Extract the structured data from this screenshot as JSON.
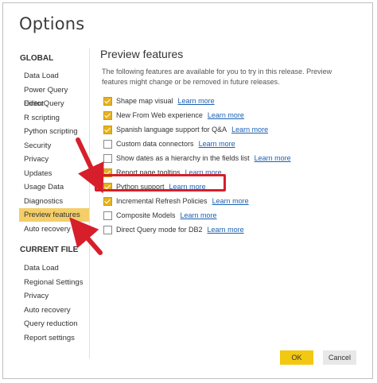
{
  "window": {
    "title": "Options"
  },
  "sidebar": {
    "global_header": "GLOBAL",
    "global_items": [
      "Data Load",
      "Power Query Editor",
      "DirectQuery",
      "R scripting",
      "Python scripting",
      "Security",
      "Privacy",
      "Updates",
      "Usage Data",
      "Diagnostics",
      "Preview features",
      "Auto recovery"
    ],
    "selected_index": 10,
    "current_header": "CURRENT FILE",
    "current_items": [
      "Data Load",
      "Regional Settings",
      "Privacy",
      "Auto recovery",
      "Query reduction",
      "Report settings"
    ]
  },
  "main": {
    "title": "Preview features",
    "description": "The following features are available for you to try in this release. Preview features might change or be removed in future releases.",
    "link_label": "Learn more",
    "features": [
      {
        "label": "Shape map visual",
        "checked": true
      },
      {
        "label": "New From Web experience",
        "checked": true
      },
      {
        "label": "Spanish language support for Q&A",
        "checked": true
      },
      {
        "label": "Custom data connectors",
        "checked": false
      },
      {
        "label": "Show dates as a hierarchy in the fields list",
        "checked": false
      },
      {
        "label": "Report page tooltips",
        "checked": true
      },
      {
        "label": "Python support",
        "checked": true
      },
      {
        "label": "Incremental Refresh Policies",
        "checked": true
      },
      {
        "label": "Composite Models",
        "checked": false
      },
      {
        "label": "Direct Query mode for DB2",
        "checked": false
      }
    ]
  },
  "buttons": {
    "ok": "OK",
    "cancel": "Cancel"
  },
  "colors": {
    "accent": "#f2c811",
    "selected_bg": "#f3ce69",
    "annotation": "#d61f2b",
    "link": "#1a5fb4"
  }
}
